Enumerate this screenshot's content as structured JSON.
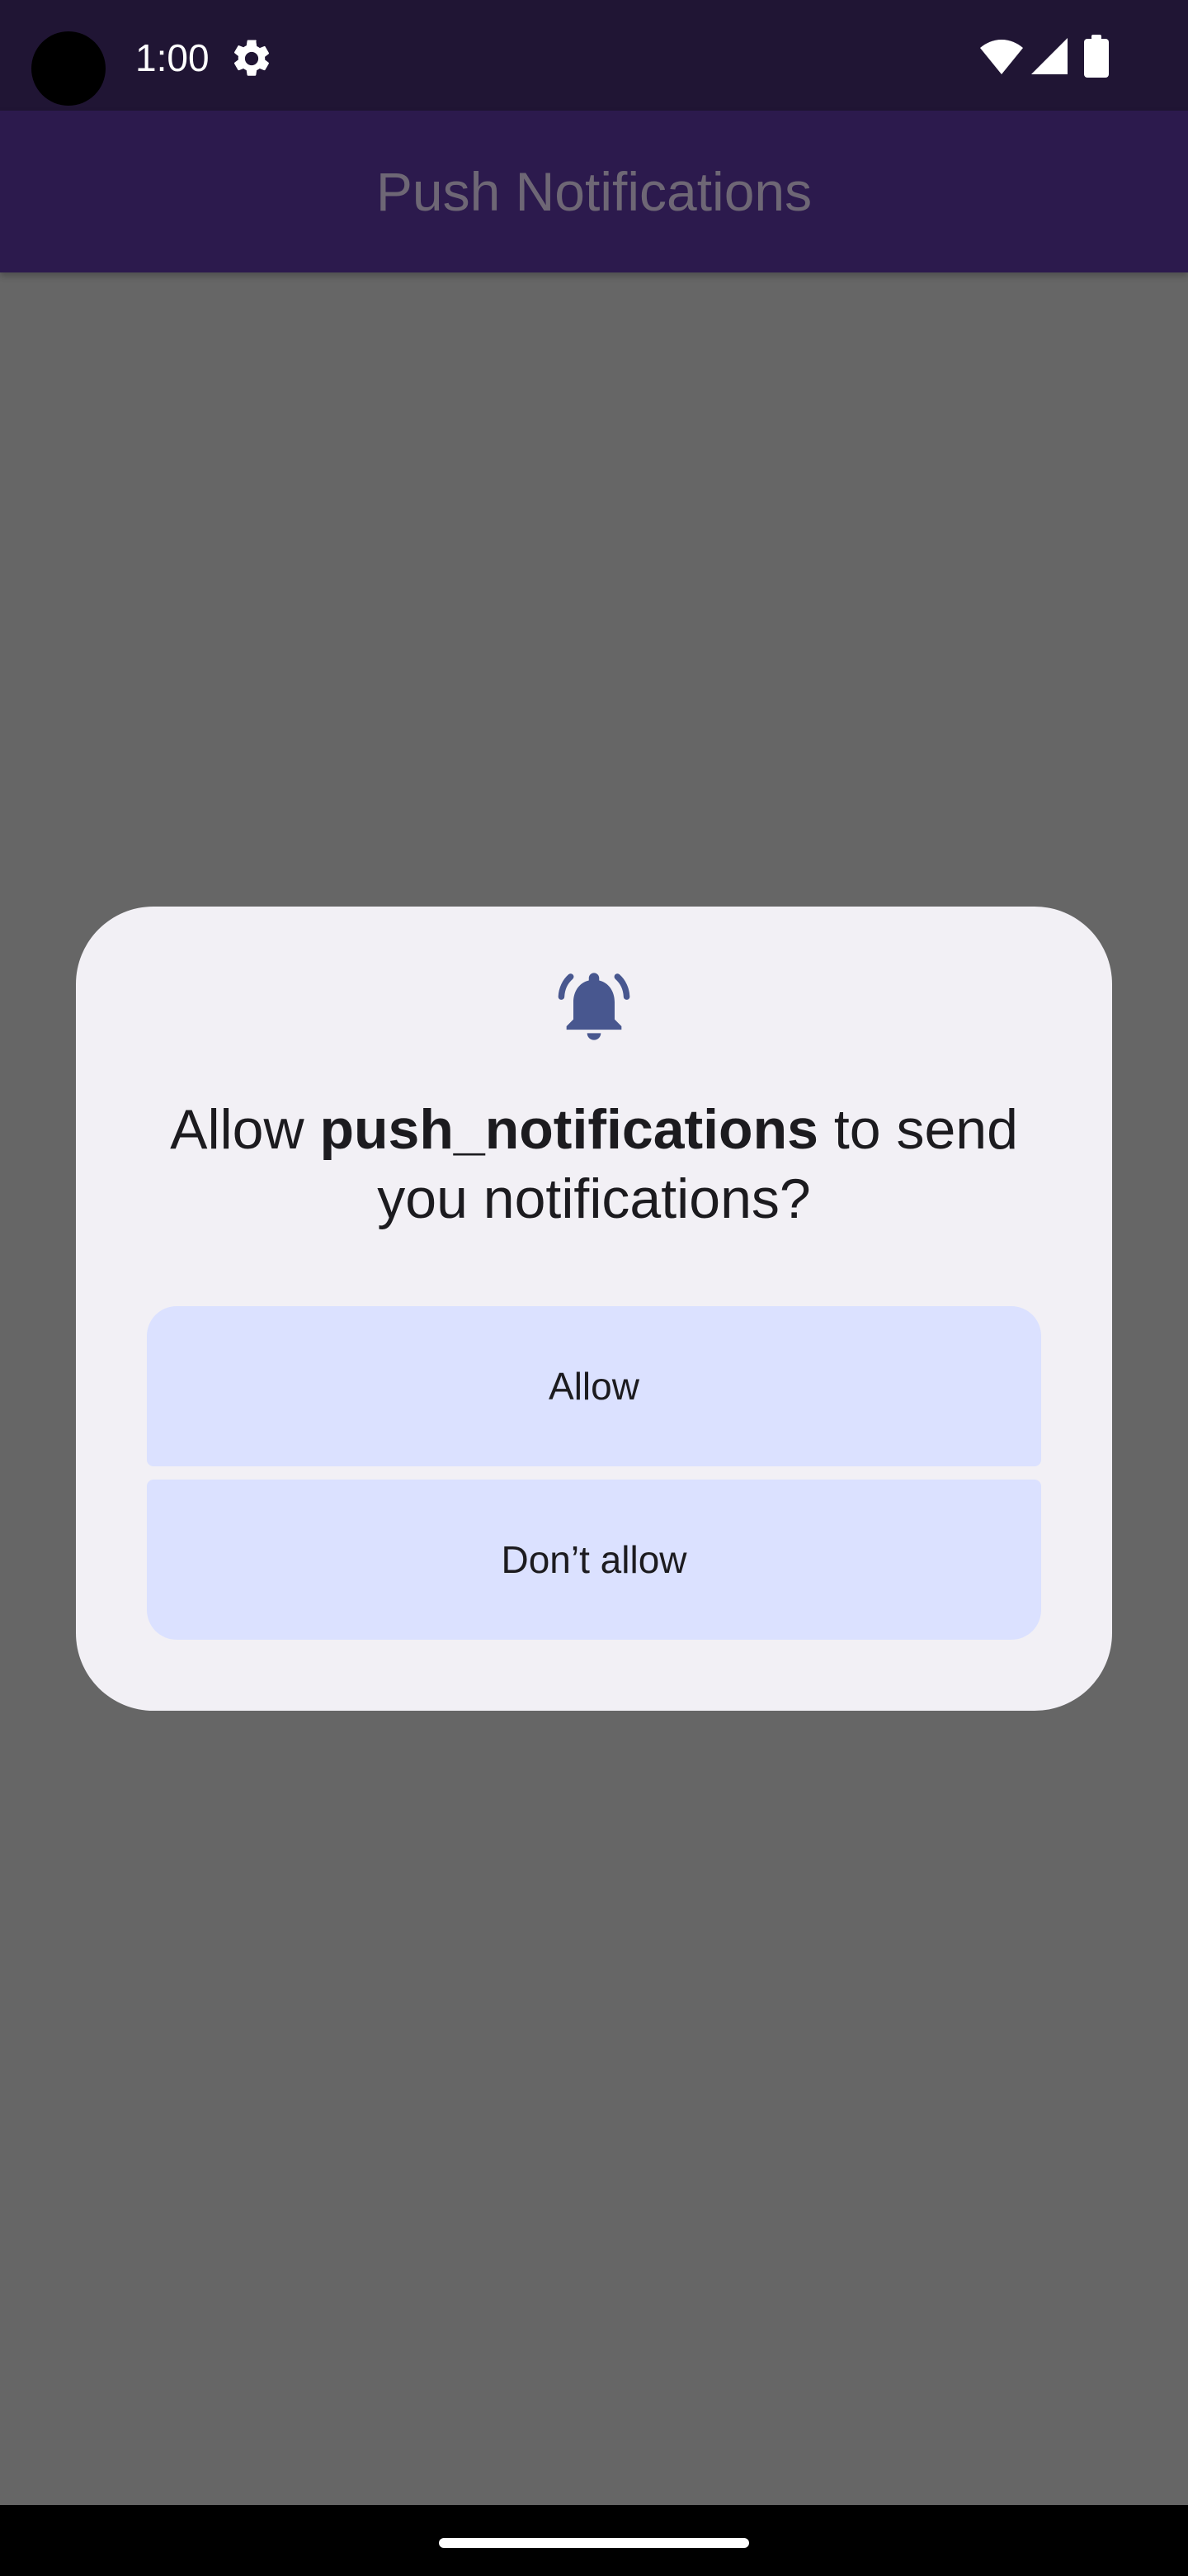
{
  "status_bar": {
    "time": "1:00",
    "icons": [
      "settings-gear-icon",
      "wifi-icon",
      "cellular-signal-icon",
      "battery-icon"
    ]
  },
  "app_bar": {
    "title": "Push Notifications"
  },
  "dialog": {
    "icon": "notification-bell-icon",
    "message_prefix": "Allow ",
    "message_app": "push_notifications",
    "message_suffix": " to send you notifications?",
    "allow_label": "Allow",
    "deny_label": "Don’t allow"
  },
  "colors": {
    "status_bar_bg": "#201534",
    "app_bar_bg": "#2c1a4d",
    "scrim": "#666666",
    "dialog_bg": "#f2f0f5",
    "button_bg": "#dbe1ff",
    "bell_icon": "#48578f"
  }
}
